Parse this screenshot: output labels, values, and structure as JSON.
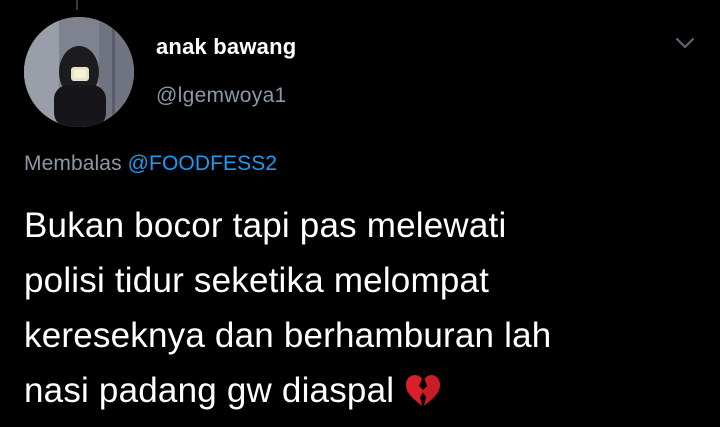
{
  "tweet": {
    "display_name": "anak bawang",
    "handle": "@lgemwoya1",
    "reply_prefix": "Membalas",
    "reply_to": "@FOODFESS2",
    "text_lines": [
      "Bukan bocor tapi pas melewati",
      "polisi tidur seketika melompat",
      "kereseknya dan berhamburan lah",
      "nasi padang gw diaspal"
    ],
    "emoji": "broken-heart-icon"
  },
  "icons": {
    "caret": "chevron-down-icon",
    "avatar": "avatar"
  },
  "colors": {
    "background": "#000000",
    "primary_text": "#ffffff",
    "secondary_text": "#8b98a5",
    "accent": "#1d9bf0",
    "emoji_red": "#d9202a"
  }
}
